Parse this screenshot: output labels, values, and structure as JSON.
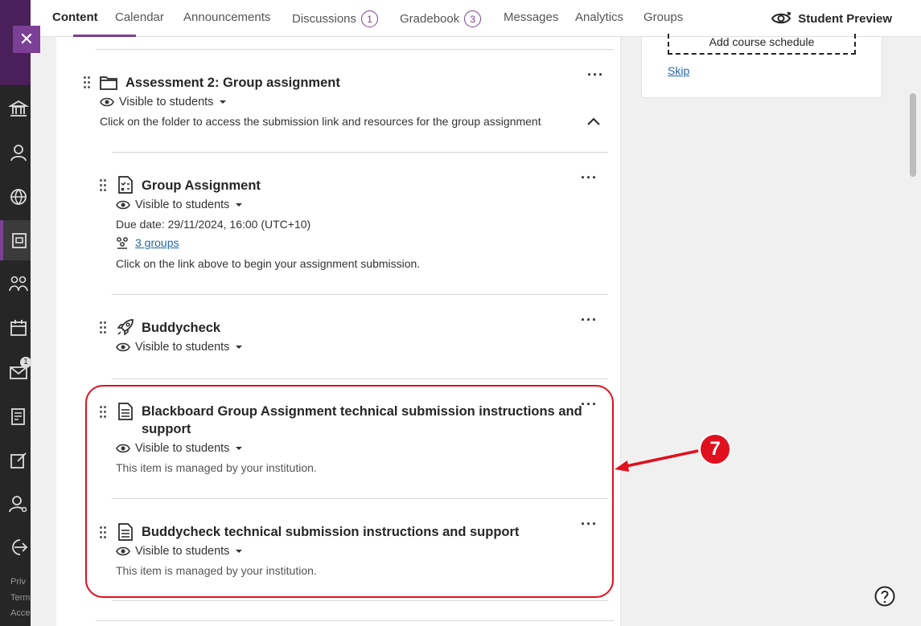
{
  "tabs": [
    {
      "label": "Content",
      "active": true
    },
    {
      "label": "Calendar"
    },
    {
      "label": "Announcements"
    },
    {
      "label": "Discussions",
      "count": "1"
    },
    {
      "label": "Gradebook",
      "count": "3"
    },
    {
      "label": "Messages"
    },
    {
      "label": "Analytics"
    },
    {
      "label": "Groups"
    }
  ],
  "student_preview": "Student Preview",
  "sidebar": {
    "footer_lines": [
      "Priv",
      "Term",
      "Acce"
    ],
    "badge": "1"
  },
  "right_card": {
    "schedule_button": "Add course schedule",
    "skip_link": "Skip"
  },
  "folder": {
    "title": "Assessment 2: Group assignment",
    "visibility": "Visible to students",
    "description": "Click on the folder to access the submission link and resources for the group assignment"
  },
  "items": [
    {
      "title": "Group Assignment",
      "visibility": "Visible to students",
      "due": "Due date: 29/11/2024, 16:00 (UTC+10)",
      "groups_link": "3 groups",
      "description": "Click on the link above to begin your assignment submission."
    },
    {
      "title": "Buddycheck",
      "visibility": "Visible to students"
    },
    {
      "title_line1": "Blackboard Group Assignment technical submission instructions and",
      "title_line2": "support",
      "visibility": "Visible to students",
      "note": "This item is managed by your institution."
    },
    {
      "title": "Buddycheck technical submission instructions and support",
      "visibility": "Visible to students",
      "note": "This item is managed by your institution."
    }
  ],
  "annotation": {
    "number": "7",
    "color": "#e0101e"
  },
  "colors": {
    "accent": "#7b3f96",
    "link": "#2468a8",
    "rail": "#262626"
  }
}
